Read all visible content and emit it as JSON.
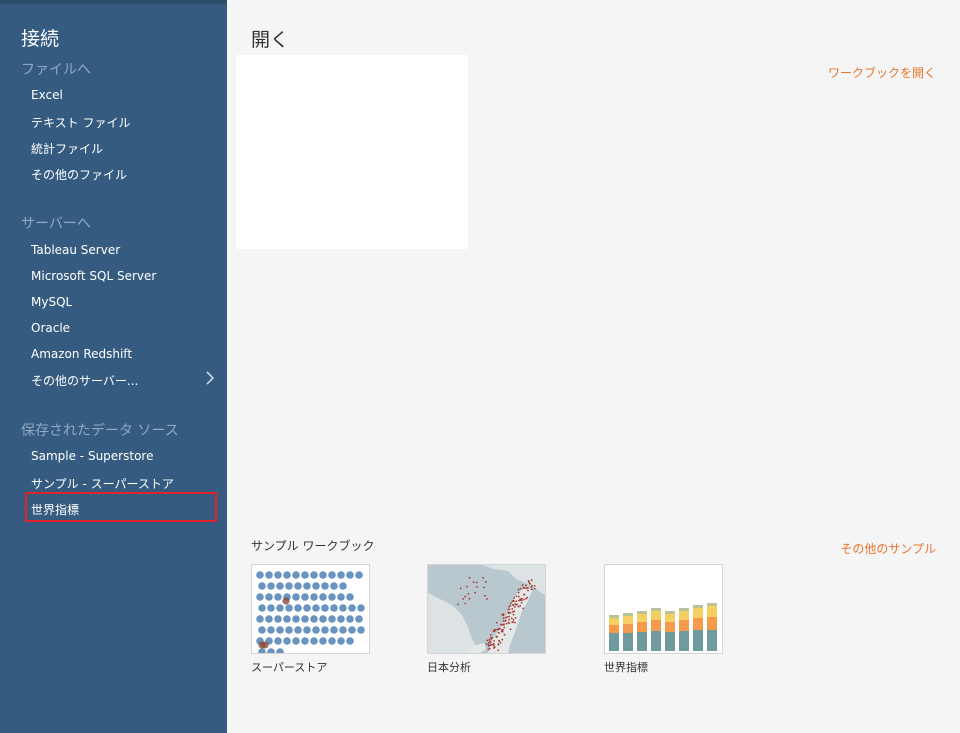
{
  "sidebar": {
    "title": "接続",
    "sections": [
      {
        "heading": "ファイルへ",
        "items": [
          "Excel",
          "テキスト ファイル",
          "統計ファイル",
          "その他のファイル"
        ]
      },
      {
        "heading": "サーバーへ",
        "items": [
          "Tableau Server",
          "Microsoft SQL Server",
          "MySQL",
          "Oracle",
          "Amazon Redshift",
          "その他のサーバー..."
        ]
      },
      {
        "heading": "保存されたデータ ソース",
        "items": [
          "Sample - Superstore",
          "サンプル - スーパーストア",
          "世界指標"
        ]
      }
    ],
    "more_servers_icon": "chevron-right-icon",
    "highlight_color": "#e0242a"
  },
  "main": {
    "open_title": "開く",
    "open_workbook_link": "ワークブックを開く",
    "samples_title": "サンプル ワークブック",
    "more_samples_link": "その他のサンプル",
    "samples": [
      {
        "label": "スーパーストア",
        "thumbnail": "scatter-dots-thumbnail"
      },
      {
        "label": "日本分析",
        "thumbnail": "japan-map-thumbnail"
      },
      {
        "label": "世界指標",
        "thumbnail": "stacked-bar-thumbnail"
      }
    ]
  },
  "colors": {
    "sidebar_bg": "#355c80",
    "sidebar_heading": "#8fa9c4",
    "link": "#e8762d",
    "main_bg": "#f5f5f5"
  }
}
